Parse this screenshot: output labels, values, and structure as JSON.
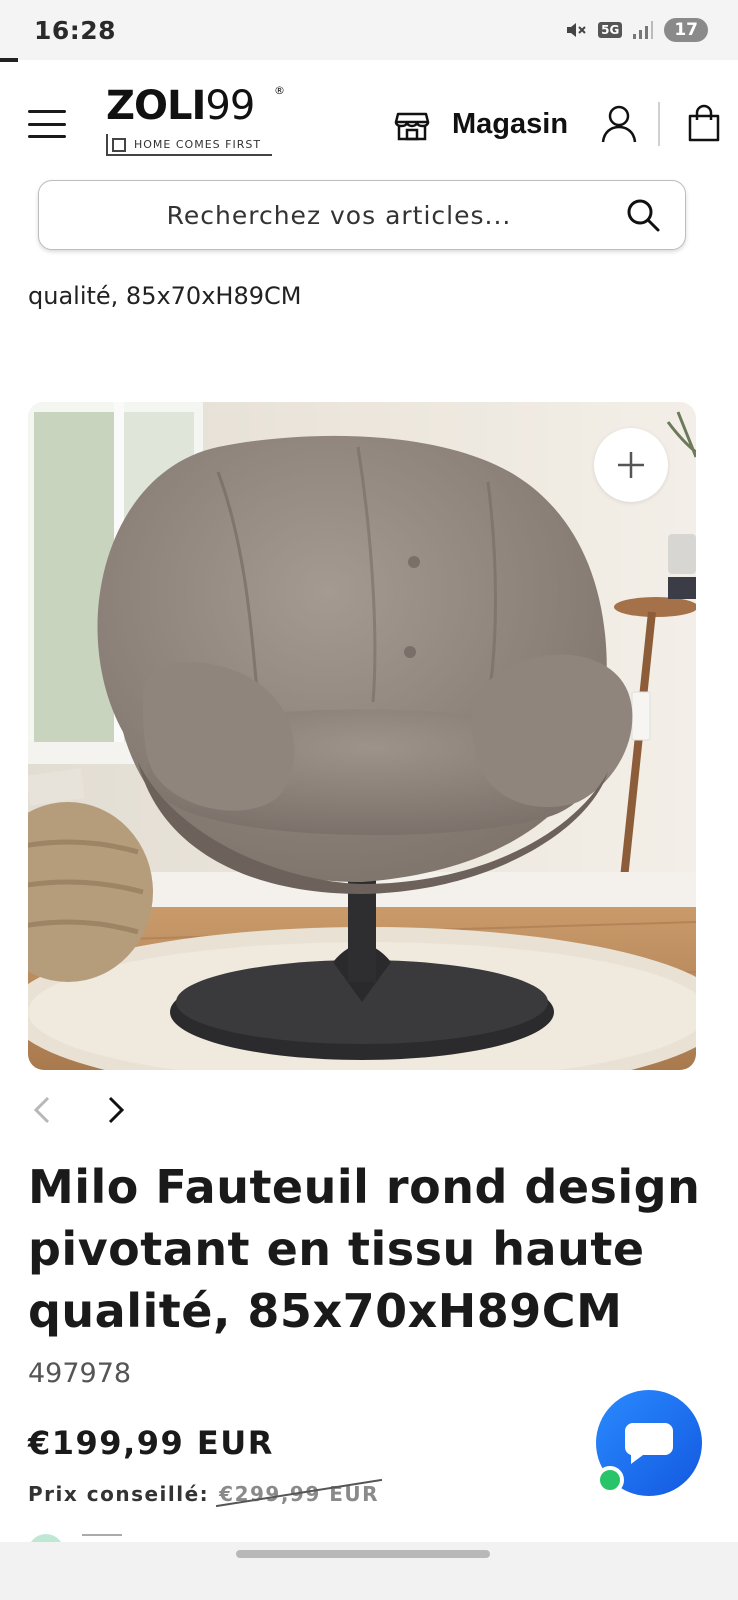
{
  "status_bar": {
    "time": "16:28",
    "network": "5G",
    "battery": "17",
    "icons": [
      "mute-icon",
      "network-5g-icon",
      "signal-icon",
      "battery-icon"
    ]
  },
  "header": {
    "logo_text_bold": "ZOLI",
    "logo_text_light": "99",
    "logo_registered": "®",
    "logo_tagline": "HOME COMES FIRST",
    "store_label": "Magasin",
    "icons": [
      "menu-icon",
      "store-icon",
      "user-icon",
      "cart-icon"
    ]
  },
  "search": {
    "placeholder": "Recherchez vos articles..."
  },
  "breadcrumb_title": "qualité, 85x70xH89CM",
  "product": {
    "title": "Milo Fauteuil rond design pivotant en tissu haute qualité, 85x70xH89CM",
    "sku": "497978",
    "price": "€199,99 EUR",
    "msrp_label": "Prix conseillé:",
    "msrp_value": "€299,99 EUR"
  },
  "colors": {
    "accent_chat": "#1f6ff5",
    "online_dot": "#27c46a",
    "text": "#1a1a1a"
  }
}
